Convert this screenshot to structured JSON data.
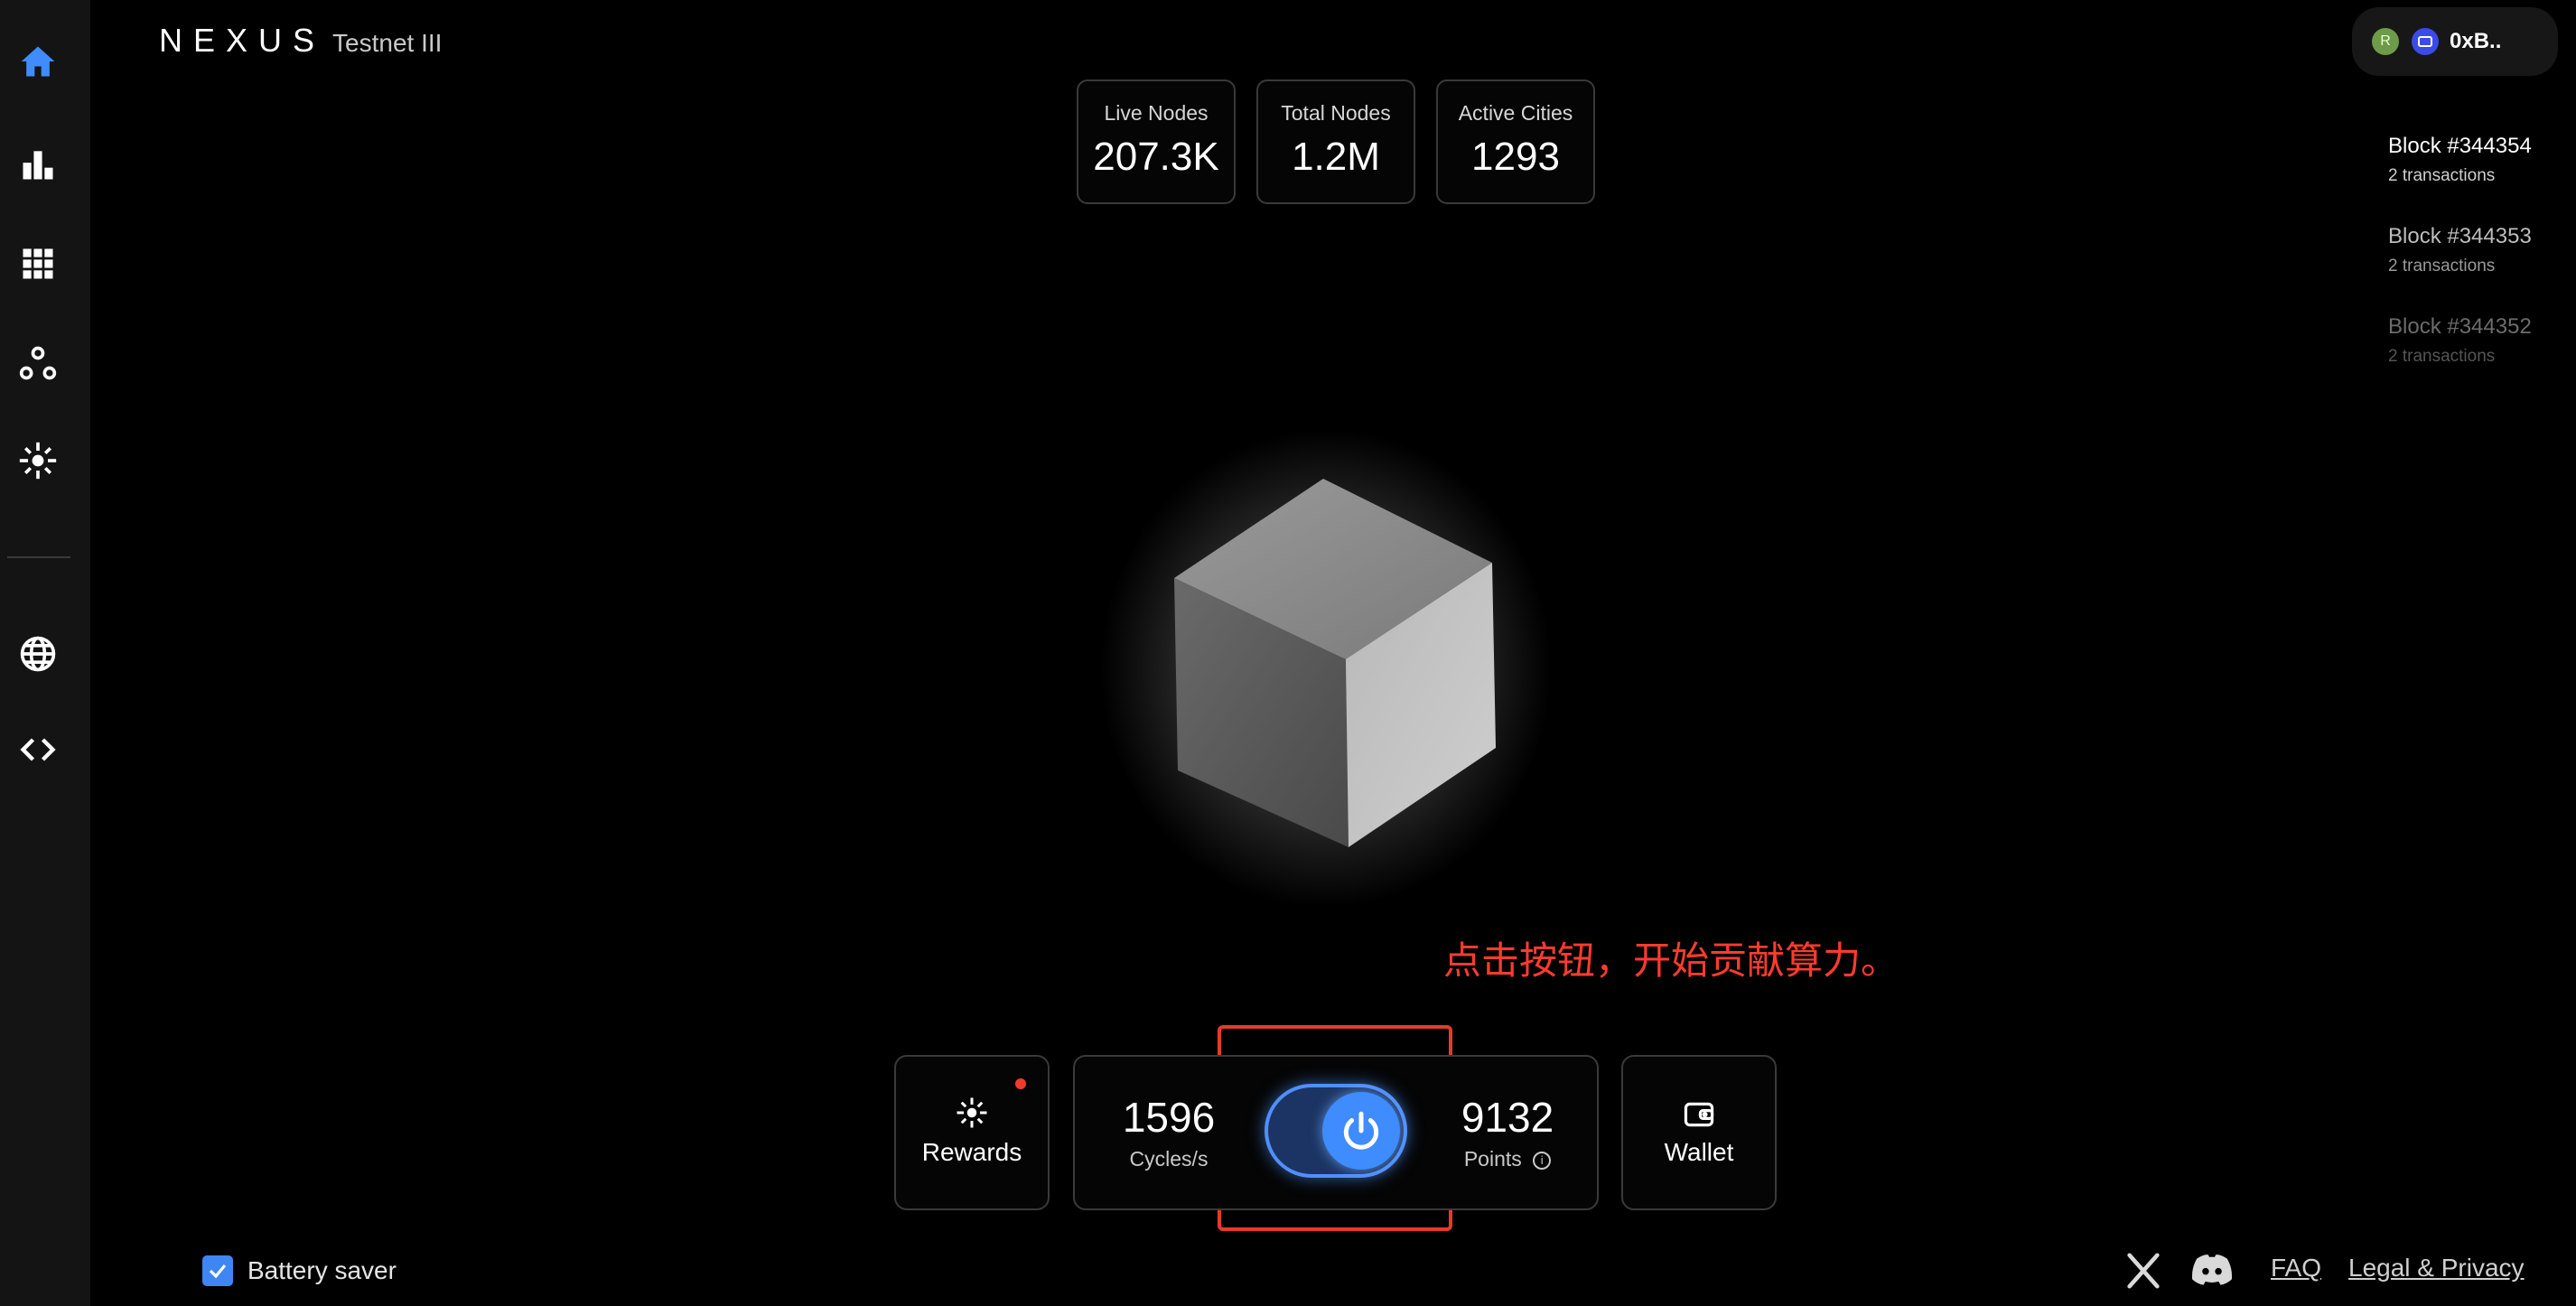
{
  "brand": {
    "logo": "NEXUS",
    "network": "Testnet III"
  },
  "account": {
    "avatar_letter": "R",
    "address": "0xB.."
  },
  "sidebar": {
    "items": [
      {
        "icon": "home-icon",
        "active": true
      },
      {
        "icon": "bar-chart-icon"
      },
      {
        "icon": "apps-grid-icon"
      },
      {
        "icon": "network-nodes-icon"
      },
      {
        "icon": "sparkle-icon"
      },
      {
        "icon": "globe-icon"
      },
      {
        "icon": "code-icon"
      }
    ]
  },
  "stats": [
    {
      "label": "Live Nodes",
      "value": "207.3K"
    },
    {
      "label": "Total Nodes",
      "value": "1.2M"
    },
    {
      "label": "Active Cities",
      "value": "1293"
    }
  ],
  "blocks": [
    {
      "title": "Block #344354",
      "subtitle": "2 transactions"
    },
    {
      "title": "Block #344353",
      "subtitle": "2 transactions"
    },
    {
      "title": "Block #344352",
      "subtitle": "2 transactions"
    }
  ],
  "annotation": {
    "text": "点击按钮，开始贡献算力。"
  },
  "controls": {
    "rewards_label": "Rewards",
    "cycles_value": "1596",
    "cycles_unit": "Cycles/s",
    "points_value": "9132",
    "points_unit": "Points",
    "wallet_label": "Wallet",
    "toggle_on": true
  },
  "footer": {
    "battery_saver_label": "Battery saver",
    "battery_saver_checked": true,
    "faq_label": "FAQ",
    "legal_label": "Legal & Privacy"
  },
  "colors": {
    "accent_blue": "#3f8cff",
    "annotation_red": "#e8392b",
    "notification_red": "#ef3a2e"
  }
}
